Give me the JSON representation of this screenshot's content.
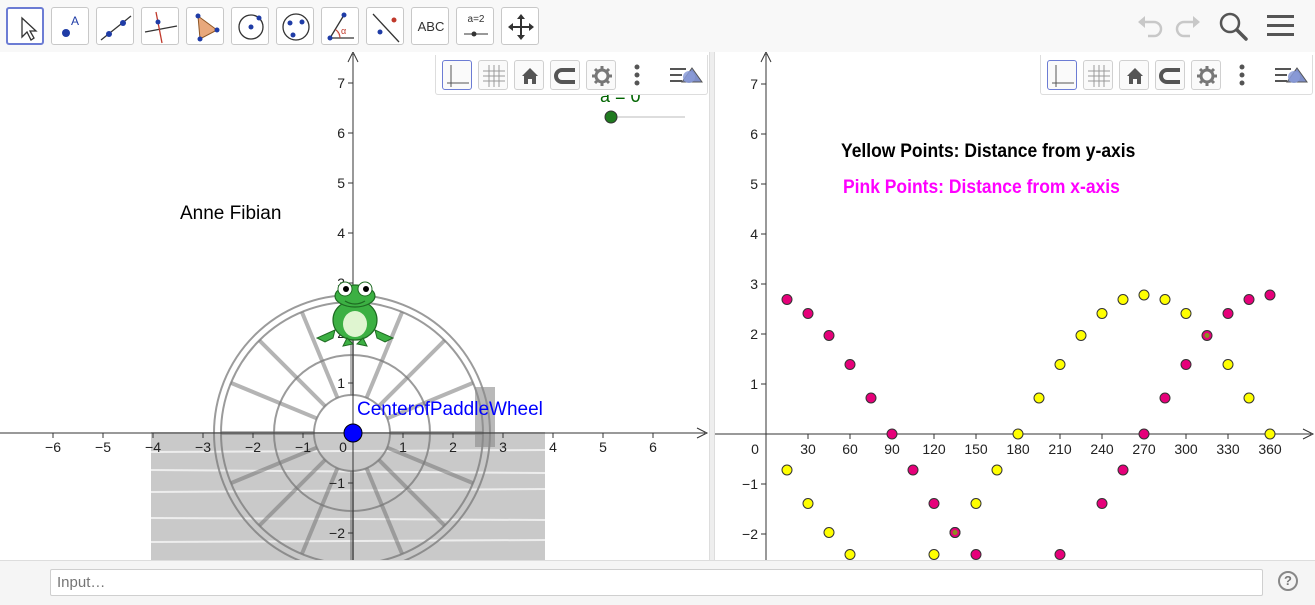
{
  "toolbar": {
    "tools": [
      {
        "name": "move-tool",
        "icon": "arrow-pointer-icon",
        "label": ""
      },
      {
        "name": "point-tool",
        "icon": "point-icon",
        "label": ""
      },
      {
        "name": "line-tool",
        "icon": "line-icon",
        "label": ""
      },
      {
        "name": "perpendicular-line-tool",
        "icon": "perpendicular-line-icon",
        "label": ""
      },
      {
        "name": "polygon-tool",
        "icon": "polygon-icon",
        "label": ""
      },
      {
        "name": "circle-center-point-tool",
        "icon": "circle-center-icon",
        "label": ""
      },
      {
        "name": "ellipse-tool",
        "icon": "ellipse-icon",
        "label": ""
      },
      {
        "name": "angle-tool",
        "icon": "angle-icon",
        "label": ""
      },
      {
        "name": "reflect-tool",
        "icon": "reflect-icon",
        "label": ""
      },
      {
        "name": "text-tool",
        "icon": "text-icon",
        "label": "ABC"
      },
      {
        "name": "slider-tool",
        "icon": "slider-icon",
        "label": "a=2"
      },
      {
        "name": "move-graphics-view-tool",
        "icon": "move-view-icon",
        "label": ""
      }
    ],
    "right": [
      "undo-icon",
      "redo-icon",
      "search-icon",
      "menu-icon"
    ]
  },
  "left_view": {
    "x_ticks": [
      "−6",
      "−5",
      "−4",
      "−3",
      "−2",
      "−1",
      "0",
      "1",
      "2",
      "3",
      "4",
      "5",
      "6"
    ],
    "y_ticks_pos": [
      "1",
      "2",
      "3",
      "4",
      "5",
      "6",
      "7"
    ],
    "y_ticks_neg": [
      "−1",
      "−2"
    ],
    "slider_label": "a = 0",
    "author": "Anne Fibian",
    "center_label": "CenterofPaddleWheel",
    "center_color": "#0000ff"
  },
  "right_view": {
    "x_ticks": [
      "0",
      "30",
      "60",
      "90",
      "120",
      "150",
      "180",
      "210",
      "240",
      "270",
      "300",
      "330",
      "360"
    ],
    "y_ticks_pos": [
      "1",
      "2",
      "3",
      "4",
      "5",
      "6",
      "7"
    ],
    "y_ticks_neg": [
      "−1",
      "−2"
    ],
    "legend_yellow": "Yellow Points:  Distance from y-axis",
    "legend_pink": "Pink Points:  Distance from x-axis",
    "yellow_color": "#ffff00",
    "pink_color": "#e6007a"
  },
  "chart_data": {
    "type": "scatter",
    "xlim": [
      -10,
      372
    ],
    "ylim": [
      -2.5,
      7.5
    ],
    "series": [
      {
        "name": "Yellow Points:  Distance from y-axis",
        "color": "#ffff00",
        "x": [
          15,
          30,
          45,
          60,
          120,
          135,
          150,
          165,
          180,
          195,
          210,
          225,
          240,
          255,
          270,
          285,
          300,
          330,
          345,
          360
        ],
        "y": [
          -0.72,
          -1.39,
          -1.97,
          -2.41,
          -2.41,
          -1.97,
          -1.39,
          -0.72,
          0,
          0.72,
          1.39,
          1.97,
          2.41,
          2.69,
          2.78,
          2.69,
          2.41,
          1.39,
          0.72,
          0
        ]
      },
      {
        "name": "Pink Points:  Distance from x-axis",
        "color": "#e6007a",
        "x": [
          15,
          30,
          45,
          60,
          75,
          90,
          105,
          120,
          150,
          210,
          240,
          255,
          270,
          285,
          300,
          330,
          345,
          360
        ],
        "y": [
          2.69,
          2.41,
          1.97,
          1.39,
          0.72,
          0,
          -0.72,
          -1.39,
          -2.41,
          -2.41,
          -1.39,
          -0.72,
          0,
          0.72,
          1.39,
          2.41,
          2.69,
          2.78
        ]
      },
      {
        "name": "",
        "color": "#8c8c20",
        "x": [
          135,
          315
        ],
        "y": [
          -1.97,
          1.97
        ]
      }
    ]
  },
  "input": {
    "placeholder": "Input…"
  },
  "help_icon": "?"
}
